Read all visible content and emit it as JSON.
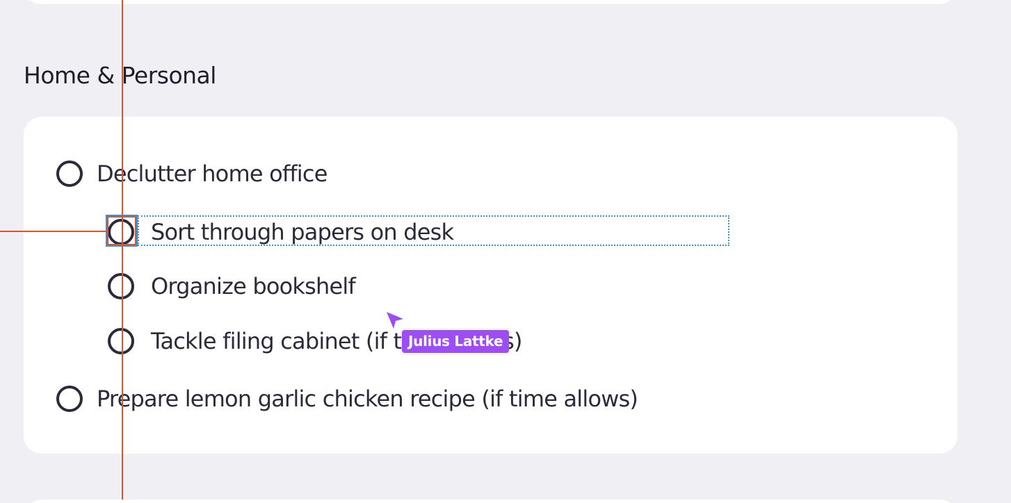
{
  "section": {
    "title": "Home & Personal"
  },
  "tasks": [
    {
      "label": "Declutter home office",
      "level": 0,
      "checked": false
    },
    {
      "label": "Sort through papers on desk",
      "level": 1,
      "checked": false,
      "selected": true
    },
    {
      "label": "Organize bookshelf",
      "level": 1,
      "checked": false
    },
    {
      "label": "Tackle filing cabinet (if time allows)",
      "level": 1,
      "checked": false
    },
    {
      "label": "Prepare lemon garlic chicken recipe (if time allows)",
      "level": 0,
      "checked": false
    }
  ],
  "collaborator": {
    "name": "Julius Lattke",
    "color": "#9c4df4"
  },
  "colors": {
    "background": "#efeff4",
    "card": "#ffffff",
    "text": "#2c2a3a",
    "guide": "#d9542a",
    "selection": "#3d8fd6"
  },
  "icons": {
    "checkbox": "circle-checkbox-icon",
    "cursor": "collaborator-cursor-icon"
  }
}
